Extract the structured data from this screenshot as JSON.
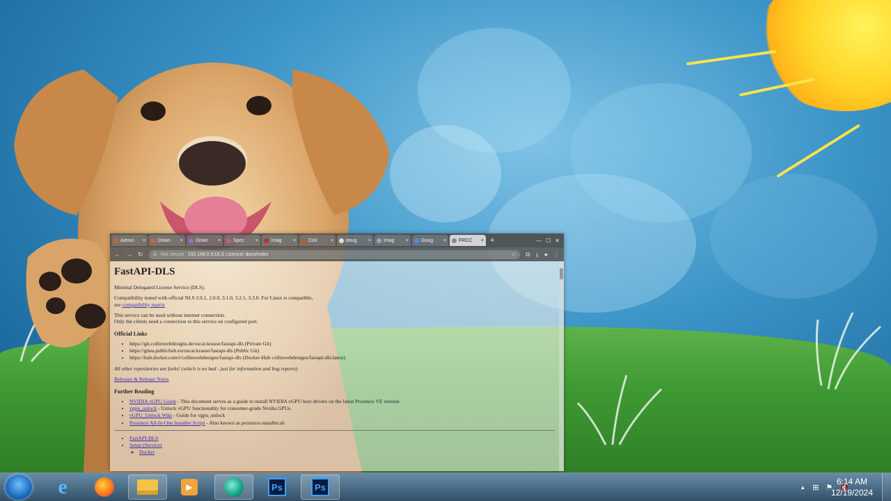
{
  "browser": {
    "tabs": [
      {
        "label": "Admin",
        "active": false
      },
      {
        "label": "Down",
        "active": false
      },
      {
        "label": "Down",
        "active": false
      },
      {
        "label": "Spec",
        "active": false
      },
      {
        "label": "Imag",
        "active": false
      },
      {
        "label": "Coll",
        "active": false
      },
      {
        "label": "doug",
        "active": false
      },
      {
        "label": "Imag",
        "active": false
      },
      {
        "label": "Goog",
        "active": false
      },
      {
        "label": "FRCC",
        "active": true
      }
    ],
    "new_tab": "+",
    "address": {
      "security": "Not secure",
      "url": "192.168.5.5:DLS Licence/ docs/index"
    }
  },
  "page": {
    "title": "FastAPI-DLS",
    "intro": "Minimal Delegated License Service (DLS).",
    "compat": "Compatibility tested with official NLS 2.0.1, 2.0.0, 3.1.0, 3.2.1, 3.3.0. For Linux is compatible,",
    "compat_link_prefix": "see",
    "compat_link": "compatibility matrix",
    "usage_line1": "This service can be used without internet connection.",
    "usage_line2": "Only the clients need a connection to this service on configured port.",
    "official_links_heading": "Official Links",
    "official_links": [
      "https://git.collinwebdesigns.de/oscar.krause/fastapi-dls (Private Git)",
      "https://gitea.publichub.eu/oscar.krause/fastapi-dls (Public Git)",
      "https://hub.docker.com/r/collinwebdesigns/fastapi-dls (Docker-Hub collinwebdesigns/fastapi-dls:latest)"
    ],
    "forks_note": "All other repositories are forks! (which is no bad - just for information and bug reports)",
    "releases_link": "Releases & Release Notes",
    "further_reading_heading": "Further Reading",
    "further_reading": [
      {
        "link": "NVIDIA vGPU Guide",
        "text": " - This document serves as a guide to install NVIDIA vGPU host drivers on the latest Proxmox VE version"
      },
      {
        "link": "vgpu_unlock",
        "text": " - Unlock vGPU functionality for consumer-grade Nvidia GPUs."
      },
      {
        "link": "vGPU_Unlock Wiki",
        "text": " - Guide for vgpu_unlock"
      },
      {
        "link": "Proxmox All-In-One Installer Script",
        "text": " - Also known as proxmox-installer.sh"
      }
    ],
    "toc": [
      {
        "label": "FastAPI-DLS",
        "level": 1
      },
      {
        "label": "Setup (Service)",
        "level": 1
      },
      {
        "label": "Docker",
        "level": 2
      }
    ]
  },
  "taskbar": {
    "clock_time": "6:14 AM",
    "clock_date": "12/19/2024",
    "ps_label": "Ps",
    "tray_up": "▲"
  },
  "colors": {
    "link": "#3a2aa8",
    "taskbar": "#2f5570",
    "sun": "#ffd425",
    "grass": "#3f9a33"
  }
}
